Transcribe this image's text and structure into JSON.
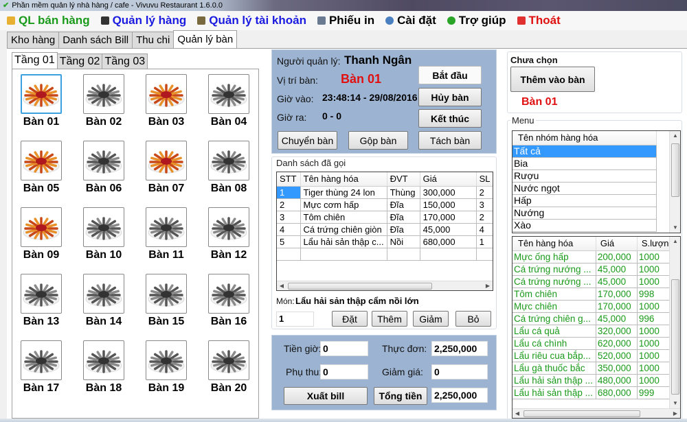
{
  "window": {
    "title": "Phần mềm quản lý nhà hàng / cafe  - Vivuvu Restaurant 1.6.0.0"
  },
  "menubar": [
    {
      "label": "QL bán hàng",
      "icon": "sales-icon",
      "color": "#1a9a1a",
      "icon_color": "#e8b030"
    },
    {
      "label": "Quản lý hàng",
      "icon": "book-icon",
      "color": "#1a1ae0",
      "icon_color": "#333333"
    },
    {
      "label": "Quản lý tài khoản",
      "icon": "user-icon",
      "color": "#1a1ae0",
      "icon_color": "#7a6a40"
    },
    {
      "label": "Phiếu in",
      "icon": "printer-icon",
      "color": "#000000",
      "icon_color": "#6a7a90"
    },
    {
      "label": "Cài đặt",
      "icon": "gear-icon",
      "color": "#000000",
      "icon_color": "#4a80c0"
    },
    {
      "label": "Trợ giúp",
      "icon": "help-icon",
      "color": "#000000",
      "icon_color": "#2aa52a"
    },
    {
      "label": "Thoát",
      "icon": "power-icon",
      "color": "#e01010",
      "icon_color": "#e03030"
    }
  ],
  "main_tabs": [
    {
      "label": "Kho hàng",
      "active": false
    },
    {
      "label": "Danh sách Bill",
      "active": false
    },
    {
      "label": "Thu chi",
      "active": false
    },
    {
      "label": "Quản lý bàn",
      "active": true
    }
  ],
  "floor_tabs": [
    {
      "label": "Tầng 01",
      "active": true
    },
    {
      "label": "Tầng 02",
      "active": false
    },
    {
      "label": "Tầng 03",
      "active": false
    }
  ],
  "tables": [
    {
      "label": "Bàn 01",
      "occupied": true,
      "selected": true
    },
    {
      "label": "Bàn 02",
      "occupied": false
    },
    {
      "label": "Bàn 03",
      "occupied": true
    },
    {
      "label": "Bàn 04",
      "occupied": false
    },
    {
      "label": "Bàn 05",
      "occupied": true
    },
    {
      "label": "Bàn 06",
      "occupied": false
    },
    {
      "label": "Bàn 07",
      "occupied": true
    },
    {
      "label": "Bàn 08",
      "occupied": false
    },
    {
      "label": "Bàn 09",
      "occupied": true
    },
    {
      "label": "Bàn 10",
      "occupied": false
    },
    {
      "label": "Bàn 11",
      "occupied": false
    },
    {
      "label": "Bàn 12",
      "occupied": false
    },
    {
      "label": "Bàn 13",
      "occupied": false
    },
    {
      "label": "Bàn 14",
      "occupied": false
    },
    {
      "label": "Bàn 15",
      "occupied": false
    },
    {
      "label": "Bàn 16",
      "occupied": false
    },
    {
      "label": "Bàn 17",
      "occupied": false
    },
    {
      "label": "Bàn 18",
      "occupied": false
    },
    {
      "label": "Bàn 19",
      "occupied": false
    },
    {
      "label": "Bàn 20",
      "occupied": false
    }
  ],
  "info": {
    "manager_label": "Người quản lý:",
    "manager_value": "Thanh Ngân",
    "table_label": "Vị trí bàn:",
    "table_value": "Bàn 01",
    "checkin_label": "Giờ vào:",
    "checkin_value": "23:48:14 - 29/08/2016",
    "checkout_label": "Giờ ra:",
    "checkout_value": "0 - 0",
    "start_button": "Bắt đầu",
    "cancel_button": "Hủy bàn",
    "end_button": "Kết thúc",
    "move_button": "Chuyển bàn",
    "merge_button": "Gộp bàn",
    "split_button": "Tách bàn",
    "accent_red": "#e01010"
  },
  "orders": {
    "title": "Danh sách đã gọi",
    "columns": [
      "STT",
      "Tên hàng hóa",
      "ĐVT",
      "Giá",
      "SL"
    ],
    "rows": [
      [
        "1",
        "Tiger thùng 24 lon",
        "Thùng",
        "300,000",
        "2"
      ],
      [
        "2",
        "Mực cơm hấp",
        "Đĩa",
        "150,000",
        "3"
      ],
      [
        "3",
        "Tôm chiên",
        "Đĩa",
        "170,000",
        "2"
      ],
      [
        "4",
        "Cá trứng chiên giòn",
        "Đĩa",
        "45,000",
        "4"
      ],
      [
        "5",
        "Lẩu hải sản thập c...",
        "Nồi",
        "680,000",
        "1"
      ]
    ],
    "dish_label": "Món:",
    "dish_value": "Lẩu hải sản thập cẩm nồi lớn",
    "quantity_value": "1",
    "order_button": "Đặt",
    "add_button": "Thêm",
    "decrease_button": "Giảm",
    "remove_button": "Bỏ"
  },
  "bill": {
    "time_fee_label": "Tiền giờ:",
    "time_fee_value": "0",
    "menu_total_label": "Thực đơn:",
    "menu_total_value": "2,250,000",
    "surcharge_label": "Phụ thu:",
    "surcharge_value": "0",
    "discount_label": "Giảm giá:",
    "discount_value": "0",
    "export_button": "Xuất bill",
    "total_button": "Tổng tiền",
    "total_value": "2,250,000"
  },
  "add_panel": {
    "status": "Chưa chọn",
    "add_button": "Thêm vào bàn",
    "table_value": "Bàn 01"
  },
  "menu_panel": {
    "title": "Menu",
    "group_header": "Tên nhóm hàng hóa",
    "groups": [
      "Tất cả",
      "Bia",
      "Rượu",
      "Nước ngọt",
      "Hấp",
      "Nướng",
      "Xào"
    ],
    "selected_group": 0,
    "item_columns": [
      "Tên hàng hóa",
      "Giá",
      "S.lượng"
    ],
    "items": [
      [
        "Mực ống hấp",
        "200,000",
        "1000"
      ],
      [
        "Cá trứng nướng ...",
        "45,000",
        "1000"
      ],
      [
        "Cá trứng nướng ...",
        "45,000",
        "1000"
      ],
      [
        "Tôm chiên",
        "170,000",
        "998"
      ],
      [
        "Mực chiên",
        "170,000",
        "1000"
      ],
      [
        "Cá trứng chiên g...",
        "45,000",
        "996"
      ],
      [
        "Lẩu cá quả",
        "320,000",
        "1000"
      ],
      [
        "Lẩu cá chình",
        "620,000",
        "1000"
      ],
      [
        "Lẩu riêu cua bắp...",
        "520,000",
        "1000"
      ],
      [
        "Lẩu gà thuốc bắc",
        "350,000",
        "1000"
      ],
      [
        "Lẩu hải sản thập ...",
        "480,000",
        "1000"
      ],
      [
        "Lẩu hải sản thập ...",
        "680,000",
        "999"
      ]
    ],
    "item_color": "#1a9a1a"
  }
}
